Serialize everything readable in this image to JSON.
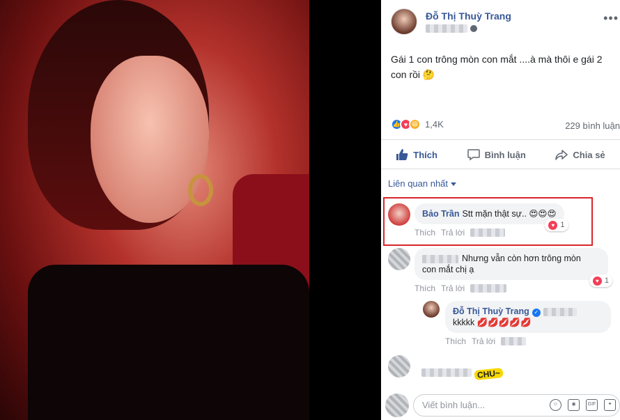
{
  "post": {
    "author": "Đỗ Thị Thuỳ Trang",
    "text_line1": "Gái 1 con trông mòn con mắt ....à mà thôi e gái 2",
    "text_line2": "con rồi 🤔",
    "reactions_count": "1,4K",
    "comments_count": "229 bình luận"
  },
  "actions": {
    "like": "Thích",
    "comment": "Bình luận",
    "share": "Chia sẻ"
  },
  "relevance_label": "Liên quan nhất",
  "comments": [
    {
      "name": "Bảo Trần",
      "text": "Stt mặn thật sự.. 😍😍😍",
      "like": "Thích",
      "reply": "Trả lời",
      "reactions": "1"
    },
    {
      "text_line1": "Nhưng vẫn còn hơn trông mòn",
      "text_line2": "con mắt chị ạ",
      "like": "Thích",
      "reply": "Trả lời",
      "reactions": "1"
    },
    {
      "name": "Đỗ Thị Thuỳ Trang",
      "text": "kkkkk 💋💋💋💋💋",
      "like": "Thích",
      "reply": "Trả lời"
    }
  ],
  "doodle_text": "CHU~",
  "composer": {
    "placeholder": "Viết bình luận..."
  },
  "icons": {
    "more": "more-icon",
    "globe": "globe-icon",
    "like": "thumbs-up-icon",
    "comment": "speech-bubble-icon",
    "share": "share-arrow-icon"
  },
  "colors": {
    "link": "#385898",
    "like_blue": "#1877f2",
    "love_red": "#f33e58",
    "highlight_red": "#d9262a"
  }
}
